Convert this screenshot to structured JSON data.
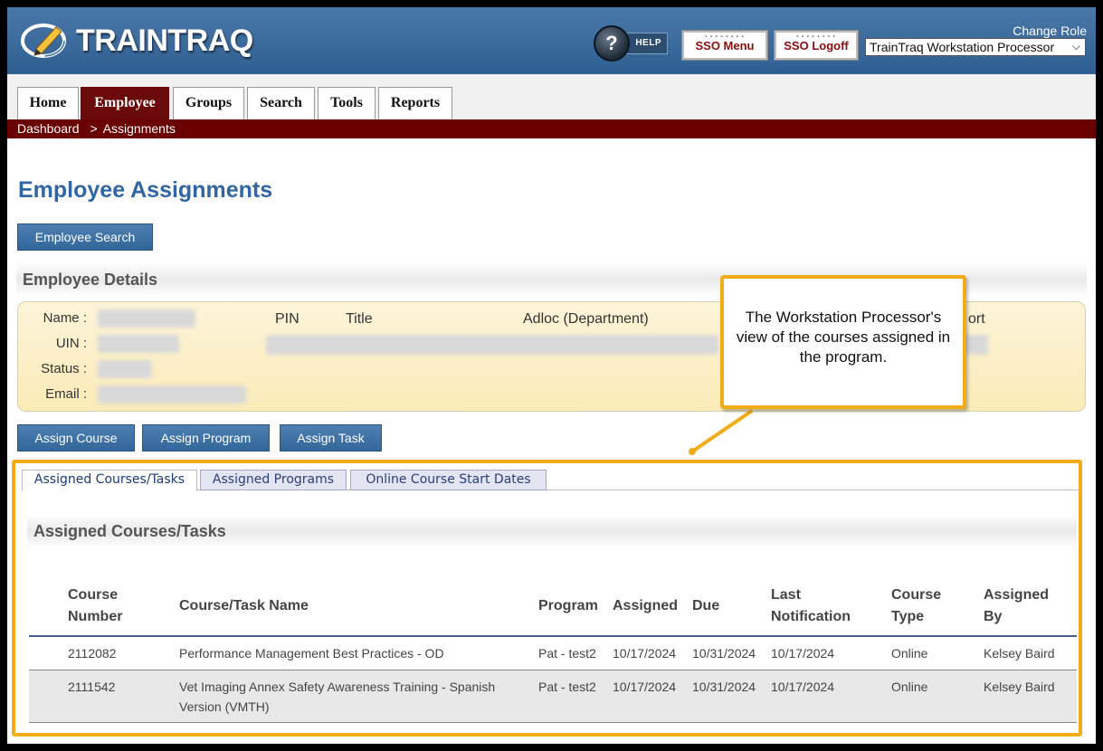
{
  "header": {
    "app_name": "TRAINTRAQ",
    "help_label": "HELP",
    "sso_menu": "SSO Menu",
    "sso_logoff": "SSO Logoff",
    "change_role": "Change Role",
    "role_value": "TrainTraq Workstation Processor"
  },
  "nav": {
    "tabs": [
      "Home",
      "Employee",
      "Groups",
      "Search",
      "Tools",
      "Reports"
    ],
    "active": "Employee"
  },
  "breadcrumb": {
    "root": "Dashboard",
    "separator": ">",
    "current": "Assignments"
  },
  "page": {
    "title": "Employee Assignments",
    "search_button": "Employee Search"
  },
  "details": {
    "heading": "Employee Details",
    "labels": {
      "name": "Name :",
      "uin": "UIN :",
      "status": "Status :",
      "email": "Email :"
    },
    "columns": {
      "pin": "PIN",
      "title": "Title",
      "adloc": "Adloc (Department)",
      "report": "ort"
    }
  },
  "actions": {
    "assign_course": "Assign Course",
    "assign_program": "Assign Program",
    "assign_task": "Assign Task"
  },
  "callout": {
    "text": "The Workstation Processor's view of the courses assigned in the program."
  },
  "subtabs": [
    "Assigned Courses/Tasks",
    "Assigned Programs",
    "Online Course Start Dates"
  ],
  "assigned": {
    "heading": "Assigned Courses/Tasks",
    "columns": {
      "course_number_1": "Course",
      "course_number_2": "Number",
      "name": "Course/Task Name",
      "program": "Program",
      "assigned": "Assigned",
      "due": "Due",
      "last_1": "Last",
      "last_2": "Notification",
      "type_1": "Course",
      "type_2": "Type",
      "by_1": "Assigned",
      "by_2": "By"
    },
    "rows": [
      {
        "number": "2112082",
        "name": "Performance Management Best Practices - OD",
        "program": "Pat - test2",
        "assigned": "10/17/2024",
        "due": "10/31/2024",
        "last": "10/17/2024",
        "type": "Online",
        "by": "Kelsey Baird"
      },
      {
        "number": "2111542",
        "name": "Vet Imaging Annex Safety Awareness Training - Spanish Version (VMTH)",
        "program": "Pat - test2",
        "assigned": "10/17/2024",
        "due": "10/31/2024",
        "last": "10/17/2024",
        "type": "Online",
        "by": "Kelsey Baird"
      }
    ]
  },
  "colors": {
    "header_blue": "#2f5f92",
    "nav_active": "#6b0a0a",
    "title_blue": "#3166a4",
    "highlight": "#f2ac18"
  }
}
